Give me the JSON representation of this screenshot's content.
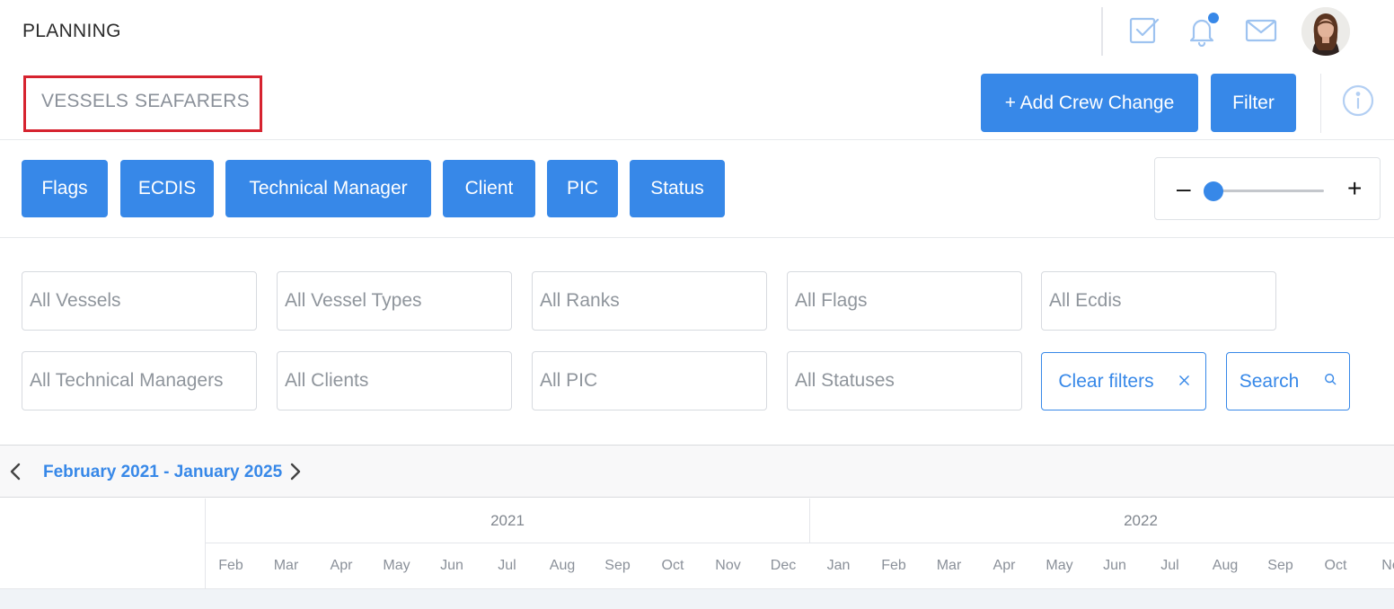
{
  "header": {
    "title": "PLANNING",
    "icons": [
      "check-square-icon",
      "bell-icon",
      "mail-icon"
    ],
    "has_notification": true
  },
  "tabs": [
    {
      "label": "VESSELS"
    },
    {
      "label": "SEAFARERS"
    }
  ],
  "actions": {
    "add_crew_change": "+ Add Crew Change",
    "filter": "Filter"
  },
  "categories": [
    "Flags",
    "ECDIS",
    "Technical Manager",
    "Client",
    "PIC",
    "Status"
  ],
  "zoom": {
    "minus": "–",
    "plus": "+",
    "level": 0.0
  },
  "filters": {
    "row1": [
      "All Vessels",
      "All Vessel Types",
      "All Ranks",
      "All Flags",
      "All Ecdis"
    ],
    "row2": [
      "All Technical Managers",
      "All Clients",
      "All PIC",
      "All Statuses"
    ],
    "clear_label": "Clear filters",
    "search_label": "Search"
  },
  "timeline": {
    "range": "February 2021 - January 2025",
    "years": [
      "2021",
      "2022"
    ],
    "months": [
      "Feb",
      "Mar",
      "Apr",
      "May",
      "Jun",
      "Jul",
      "Aug",
      "Sep",
      "Oct",
      "Nov",
      "Dec",
      "Jan",
      "Feb",
      "Mar",
      "Apr",
      "May",
      "Jun",
      "Jul",
      "Aug",
      "Sep",
      "Oct",
      "No"
    ]
  },
  "colors": {
    "accent": "#3788e8",
    "highlight_box": "#d6232f",
    "muted_text": "#8a9099"
  }
}
